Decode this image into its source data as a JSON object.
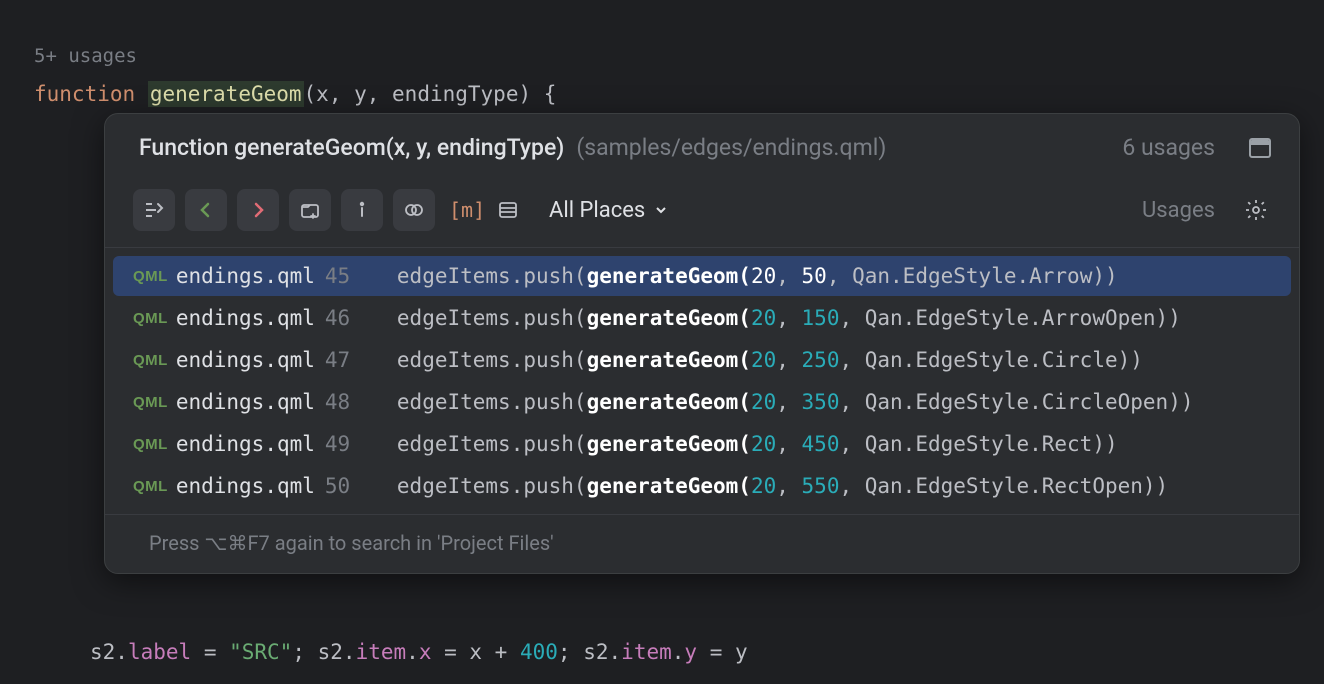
{
  "gutter": {
    "usages": "5+ usages"
  },
  "code": {
    "kw_function": "function",
    "fn_name": "generateGeom",
    "params": "(x, y, endingType) {"
  },
  "popup": {
    "titlePrefix": "Function ",
    "titleFn": "generateGeom(x, y, endingType)",
    "path": "(samples/edges/endings.qml)",
    "count": "6 usages",
    "scope": "All Places",
    "usagesLabel": "Usages",
    "mLabel": "[m]",
    "results": [
      {
        "badge": "QML",
        "file": "endings.qml",
        "line": "45",
        "pre": "edgeItems.push(",
        "bold": "generateGeom(",
        "n1": "20",
        "c1": ", ",
        "n2": "50",
        "post": ", Qan.EdgeStyle.Arrow))",
        "selected": true
      },
      {
        "badge": "QML",
        "file": "endings.qml",
        "line": "46",
        "pre": "edgeItems.push(",
        "bold": "generateGeom(",
        "n1": "20",
        "c1": ", ",
        "n2": "150",
        "post": ", Qan.EdgeStyle.ArrowOpen))",
        "selected": false
      },
      {
        "badge": "QML",
        "file": "endings.qml",
        "line": "47",
        "pre": "edgeItems.push(",
        "bold": "generateGeom(",
        "n1": "20",
        "c1": ", ",
        "n2": "250",
        "post": ", Qan.EdgeStyle.Circle))",
        "selected": false
      },
      {
        "badge": "QML",
        "file": "endings.qml",
        "line": "48",
        "pre": "edgeItems.push(",
        "bold": "generateGeom(",
        "n1": "20",
        "c1": ", ",
        "n2": "350",
        "post": ", Qan.EdgeStyle.CircleOpen))",
        "selected": false
      },
      {
        "badge": "QML",
        "file": "endings.qml",
        "line": "49",
        "pre": "edgeItems.push(",
        "bold": "generateGeom(",
        "n1": "20",
        "c1": ", ",
        "n2": "450",
        "post": ", Qan.EdgeStyle.Rect))",
        "selected": false
      },
      {
        "badge": "QML",
        "file": "endings.qml",
        "line": "50",
        "pre": "edgeItems.push(",
        "bold": "generateGeom(",
        "n1": "20",
        "c1": ", ",
        "n2": "550",
        "post": ", Qan.EdgeStyle.RectOpen))",
        "selected": false
      }
    ],
    "footer": "Press ⌥⌘F7 again to search in 'Project Files'"
  },
  "bottom": {
    "s2": "s2",
    "dot": ".",
    "label": "label",
    "eq": " = ",
    "src": "\"SRC\"",
    "semi": "; ",
    "item": "item",
    "x": "x",
    "xexpr": " = x + ",
    "fourh": "400",
    "y": "y",
    "yexpr": " = y"
  }
}
